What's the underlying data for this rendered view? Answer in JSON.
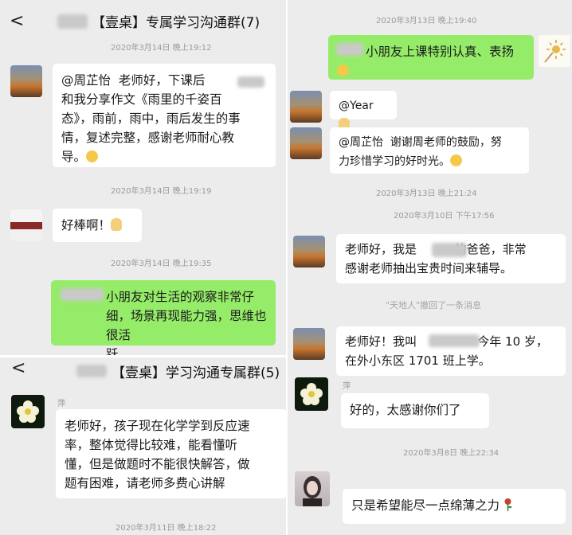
{
  "top_left": {
    "back_glyph": "<",
    "title": "【壹桌】专属学习沟通群(7)",
    "messages": [
      {
        "time": "2020年3月14日 晚上19:12"
      },
      {
        "text": "@周芷怡  老师好，下课后\n和我分享作文《雨里的千姿百\n态》，雨前，雨中，雨后发生的事\n情，复述完整，感谢老师耐心教\n导。"
      },
      {
        "time": "2020年3月14日 晚上19:19"
      },
      {
        "text": "好棒啊！"
      },
      {
        "time": "2020年3月14日 晚上19:35"
      },
      {
        "text": "小朋友对生活的观察非常仔\n细，场景再现能力强，思维也很活\n跃"
      }
    ]
  },
  "bottom_left": {
    "back_glyph": "<",
    "title": "【壹桌】学习沟通专属群(5)",
    "sender": "萍",
    "message": "老师好，孩子现在化学学到反应速\n率，整体觉得比较难，能看懂听\n懂，但是做题时不能很快解答，做\n题有困难，请老师多费心讲解",
    "time": "2020年3月11日 晚上18:22"
  },
  "right": {
    "messages": [
      {
        "time": "2020年3月13日 晚上19:40"
      },
      {
        "text": "小朋友上课特别认真、表扬"
      },
      {
        "text": "@Year"
      },
      {
        "text": "@周芷怡  谢谢周老师的鼓励，努\n力珍惜学习的好时光。"
      },
      {
        "time": "2020年3月13日 晚上21:24"
      },
      {
        "time": "2020年3月10日 下午17:56"
      },
      {
        "text": "老师好，我是          的爸爸，非常\n感谢老师抽出宝贵时间来辅导。"
      },
      {
        "system": "\"天地人\"撤回了一条消息"
      },
      {
        "text": "老师好！我叫                今年 10 岁，\n在外小东区 1701 班上学。"
      },
      {
        "sender": "萍"
      },
      {
        "text": "好的，太感谢你们了"
      },
      {
        "time": "2020年3月8日 晚上22:34"
      },
      {
        "text": "只是希望能尽一点绵薄之力"
      }
    ]
  },
  "icons": {
    "smile": "smile-emoji-icon",
    "clap": "clap-emoji-icon",
    "rose": "rose-emoji-icon"
  }
}
